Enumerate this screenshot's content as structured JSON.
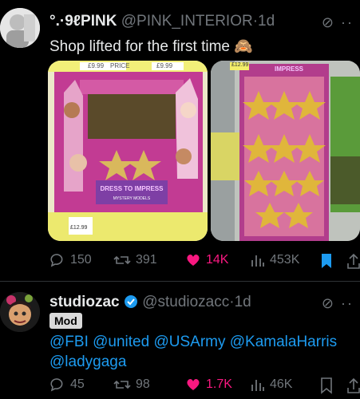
{
  "post1": {
    "display_name": "°.·9ℓPINK",
    "handle": "@PINK_INTERIOR",
    "time": "1d",
    "text": "Shop lifted for the first time",
    "emoji": "🙈",
    "media1": {
      "price_top_left": "£9.99",
      "price_top_label": "PRICE",
      "price_top_right": "£9.99",
      "brand": "DRESS TO IMPRESS",
      "subtitle": "MYSTERY MODELS",
      "price_bottom": "£12.99"
    },
    "media2": {
      "price_tag": "£12.99",
      "brand": "IMPRESS"
    },
    "replies": "150",
    "retweets": "391",
    "likes": "14K",
    "views": "453K"
  },
  "post2": {
    "display_name": "studiozac",
    "handle": "@studiozacc",
    "time": "1d",
    "badge": "Mod",
    "text_line1": "@FBI @united @USArmy @KamalaHarris",
    "text_line2": "@ladygaga",
    "replies": "45",
    "retweets": "98",
    "likes": "1.7K",
    "views": "46K"
  },
  "colors": {
    "background": "#000000",
    "accent_blue": "#1d9bf0",
    "like_pink": "#f91880",
    "muted": "#71767b"
  }
}
